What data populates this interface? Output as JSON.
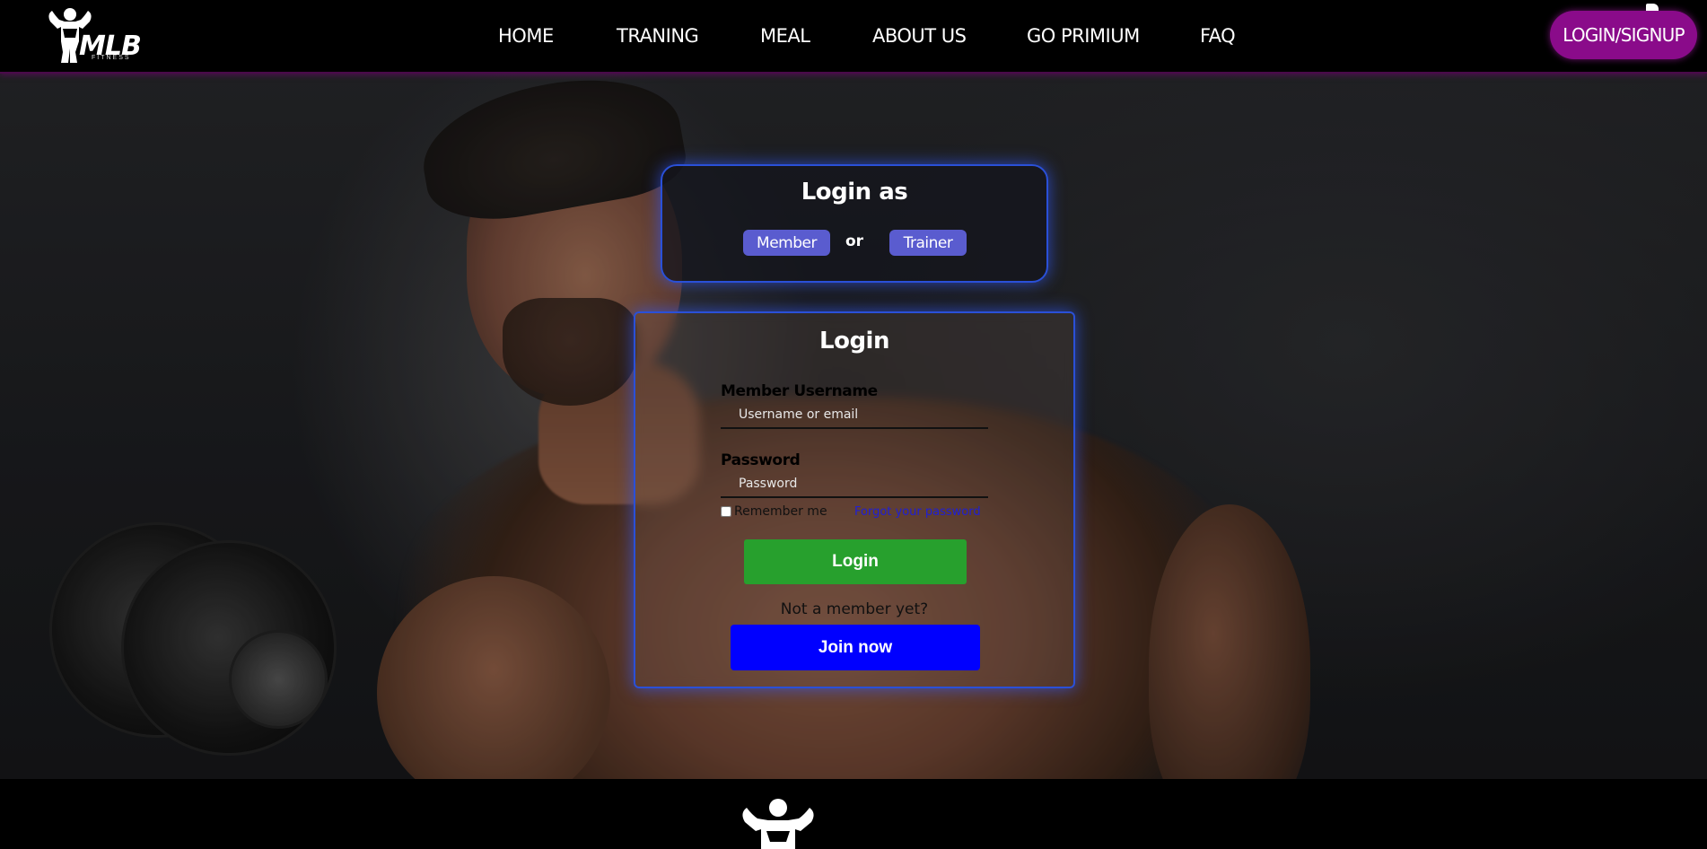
{
  "brand": {
    "logo_text": "MLB",
    "logo_sub": "FITNESS"
  },
  "nav": {
    "items": [
      {
        "label": "HOME"
      },
      {
        "label": "TRANING"
      },
      {
        "label": "MEAL"
      },
      {
        "label": "ABOUT US"
      },
      {
        "label": "GO PRIMIUM"
      },
      {
        "label": "FAQ"
      }
    ],
    "cta_label": "LOGIN/SIGNUP"
  },
  "login_as": {
    "title": "Login as",
    "member_label": "Member",
    "or_label": "or",
    "trainer_label": "Trainer"
  },
  "login_form": {
    "title": "Login",
    "username_label": "Member Username",
    "username_placeholder": "Username or email",
    "password_label": "Password",
    "password_placeholder": "Password",
    "remember_label": "Remember me",
    "remember_checked": false,
    "forgot_label": "Forgot your password",
    "submit_label": "Login",
    "not_member_text": "Not a member yet?",
    "join_label": "Join now"
  },
  "colors": {
    "accent_purple": "#8a0b8a",
    "box_border_blue": "#2a50d8",
    "role_button": "#5a5ccf",
    "login_green": "#27a02d",
    "join_blue": "#0000ff"
  }
}
